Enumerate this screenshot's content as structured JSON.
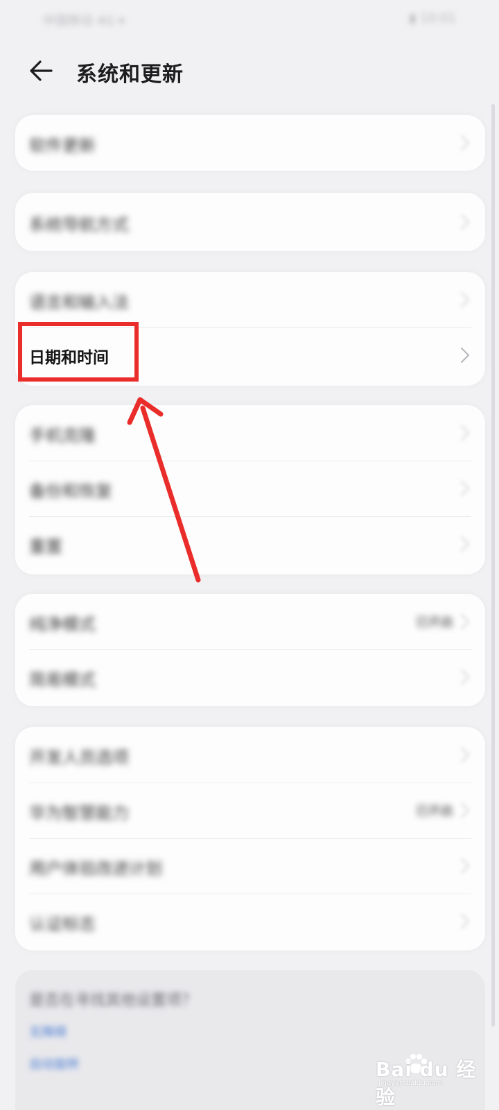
{
  "status_bar": {
    "left": "中国移动 4G ▾",
    "right": "▮ 10:01"
  },
  "header": {
    "title": "系统和更新"
  },
  "groups": [
    {
      "items": [
        {
          "label": "软件更新",
          "value": ""
        }
      ]
    },
    {
      "items": [
        {
          "label": "系统导航方式",
          "value": ""
        }
      ]
    },
    {
      "items": [
        {
          "label": "语言和输入法",
          "value": ""
        },
        {
          "label": "日期和时间",
          "value": ""
        }
      ]
    },
    {
      "items": [
        {
          "label": "手机克隆",
          "value": ""
        },
        {
          "label": "备份和恢复",
          "value": ""
        },
        {
          "label": "重置",
          "value": ""
        }
      ]
    },
    {
      "items": [
        {
          "label": "纯净模式",
          "value": "已开启"
        },
        {
          "label": "简易模式",
          "value": ""
        }
      ]
    },
    {
      "items": [
        {
          "label": "开发人员选项",
          "value": ""
        },
        {
          "label": "华为智慧能力",
          "value": "已开启"
        },
        {
          "label": "用户体验改进计划",
          "value": ""
        },
        {
          "label": "认证标志",
          "value": ""
        }
      ]
    }
  ],
  "bottom": {
    "question": "是否在寻找其他设置项？",
    "links": [
      "无障碍",
      "自动旋转"
    ]
  },
  "watermark": {
    "text": "Bai du 经验",
    "sub": "jingyan.baidu.com"
  },
  "colors": {
    "highlight": "#e92d2a",
    "link": "#4f7ed4",
    "background": "#f1f1f3"
  }
}
